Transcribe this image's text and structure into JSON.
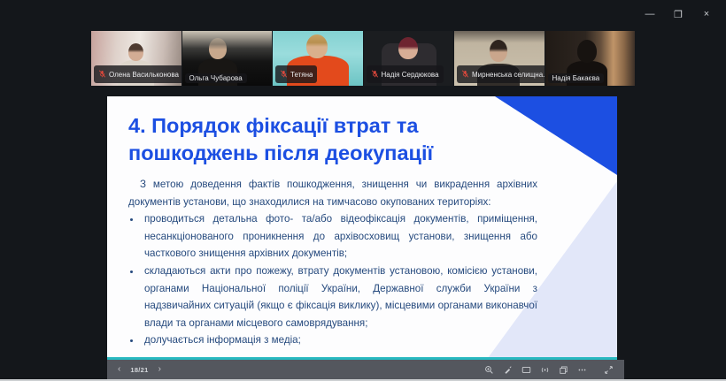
{
  "window": {
    "controls": [
      {
        "name": "minimize",
        "glyph": "—"
      },
      {
        "name": "restore",
        "glyph": "❐"
      },
      {
        "name": "close",
        "glyph": "×"
      }
    ]
  },
  "participants": [
    {
      "name": "Олена Васильконова",
      "muted": true,
      "active": false
    },
    {
      "name": "Ольга Чубарова",
      "muted": false,
      "active": true
    },
    {
      "name": "Тетяна",
      "muted": true,
      "active": false
    },
    {
      "name": "Надія Сердюкова",
      "muted": true,
      "active": false
    },
    {
      "name": "Мирненська селищна..",
      "muted": true,
      "active": false
    },
    {
      "name": "Надія Бакаєва",
      "muted": false,
      "active": false
    }
  ],
  "slide": {
    "title": "4. Порядок фіксації втрат та пошкоджень після деокупації",
    "intro": "З метою доведення фактів пошкодження, знищення чи викрадення архівних документів установи, що знаходилися на тимчасово окупованих територіях:",
    "bullets": [
      "проводиться детальна фото- та/або відеофіксація документів, приміщення, несанкціонованого проникнення до архівосховищ установи, знищення або часткового знищення архівних документів;",
      "складаються акти про пожежу, втрату документів установою, комісією установи, органами Національної поліції України, Державної служби України з надзвичайних ситуацій (якщо є фіксація виклику), місцевими органами виконавчої влади та органами місцевого самоврядування;",
      "долучається інформація з медіа;"
    ]
  },
  "toolbar": {
    "prev_glyph": "‹",
    "page_indicator": "18/21",
    "next_glyph": "›",
    "icons": [
      "zoom-in-icon",
      "laser-pointer-icon",
      "screen-icon",
      "broadcast-icon",
      "pages-icon",
      "more-icon",
      "fullscreen-icon"
    ]
  },
  "colors": {
    "accent_blue": "#1c4fe2",
    "body_text": "#264a7e",
    "teal_bar": "#28b8c0",
    "active_speaker_border": "#25bd68",
    "muted_mic_red": "#e0483c",
    "corner_lavender": "#e2e7f9",
    "toolbar_gray": "#54575e"
  }
}
